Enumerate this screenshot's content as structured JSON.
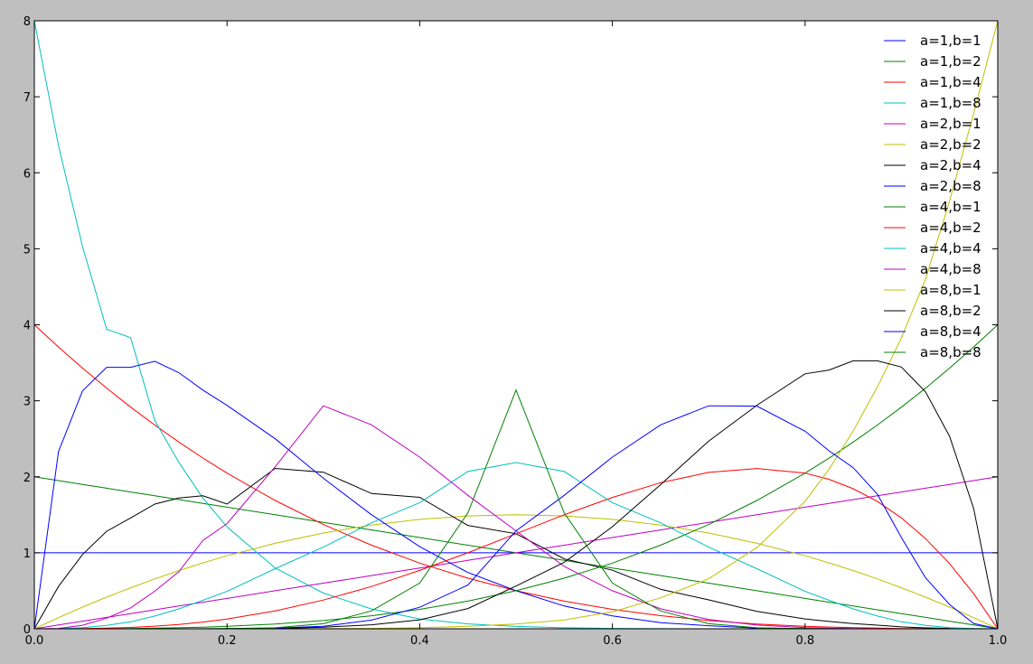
{
  "chart_data": {
    "type": "line",
    "title": "",
    "xlabel": "",
    "ylabel": "",
    "xlim": [
      0.0,
      1.0
    ],
    "ylim": [
      0,
      8
    ],
    "xticks": [
      0.0,
      0.2,
      0.4,
      0.6,
      0.8,
      1.0
    ],
    "xtick_labels": [
      "0.0",
      "0.2",
      "0.4",
      "0.6",
      "0.8",
      "1.0"
    ],
    "yticks": [
      0,
      1,
      2,
      3,
      4,
      5,
      6,
      7,
      8
    ],
    "ytick_labels": [
      "0",
      "1",
      "2",
      "3",
      "4",
      "5",
      "6",
      "7",
      "8"
    ],
    "grid": false,
    "legend_position": "top-right",
    "x_samples": [
      0,
      0.025,
      0.05,
      0.075,
      0.1,
      0.125,
      0.15,
      0.175,
      0.2,
      0.25,
      0.3,
      0.35,
      0.4,
      0.45,
      0.5,
      0.55,
      0.6,
      0.65,
      0.7,
      0.75,
      0.8,
      0.825,
      0.85,
      0.875,
      0.9,
      0.925,
      0.95,
      0.975,
      1
    ],
    "series": [
      {
        "name": "a=1,b=1",
        "color": "#0000ff",
        "y": [
          1,
          1,
          1,
          1,
          1,
          1,
          1,
          1,
          1,
          1,
          1,
          1,
          1,
          1,
          1,
          1,
          1,
          1,
          1,
          1,
          1,
          1,
          1,
          1,
          1,
          1,
          1,
          1,
          1
        ]
      },
      {
        "name": "a=1,b=2",
        "color": "#008000",
        "y": [
          2,
          1.95,
          1.9,
          1.85,
          1.8,
          1.75,
          1.7,
          1.65,
          1.6,
          1.5,
          1.4,
          1.3,
          1.2,
          1.1,
          1,
          0.9,
          0.8,
          0.7,
          0.6,
          0.5,
          0.4,
          0.35,
          0.3,
          0.25,
          0.2,
          0.15,
          0.1,
          0.05,
          0
        ]
      },
      {
        "name": "a=1,b=4",
        "color": "#ff0000",
        "y": [
          4,
          3.707,
          3.43,
          3.167,
          2.916,
          2.68,
          2.457,
          2.247,
          2.048,
          1.688,
          1.372,
          1.099,
          0.864,
          0.666,
          0.5,
          0.364,
          0.256,
          0.172,
          0.108,
          0.063,
          0.032,
          0.022,
          0.014,
          0.008,
          0.004,
          0.002,
          0.0005,
          6e-05,
          0
        ]
      },
      {
        "name": "a=1,b=8",
        "color": "#00bfbf",
        "y": [
          8,
          6.36,
          5.03,
          3.94,
          3.83,
          2.74,
          2.19,
          1.72,
          1.34,
          0.8,
          0.47,
          0.26,
          0.13,
          0.064,
          0.031,
          0.013,
          0.005,
          0.0017,
          0.0005,
          0.0001,
          0,
          0,
          0,
          0,
          0,
          0,
          0,
          0,
          0
        ]
      },
      {
        "name": "a=2,b=1",
        "color": "#bf00bf",
        "y": [
          0,
          0.05,
          0.1,
          0.15,
          0.2,
          0.25,
          0.3,
          0.35,
          0.4,
          0.5,
          0.6,
          0.7,
          0.8,
          0.9,
          1,
          1.1,
          1.2,
          1.3,
          1.4,
          1.5,
          1.6,
          1.65,
          1.7,
          1.75,
          1.8,
          1.85,
          1.9,
          1.95,
          2
        ]
      },
      {
        "name": "a=2,b=2",
        "color": "#bfbf00",
        "y": [
          0,
          0.146,
          0.285,
          0.416,
          0.54,
          0.656,
          0.765,
          0.866,
          0.96,
          1.125,
          1.26,
          1.365,
          1.44,
          1.485,
          1.5,
          1.485,
          1.44,
          1.365,
          1.26,
          1.125,
          0.96,
          0.866,
          0.765,
          0.656,
          0.54,
          0.416,
          0.285,
          0.146,
          0
        ]
      },
      {
        "name": "a=2,b=4",
        "color": "#000000",
        "y": [
          0,
          0.556,
          0.977,
          1.283,
          1.458,
          1.64,
          1.72,
          1.75,
          1.64,
          2.11,
          2.06,
          1.78,
          1.73,
          1.36,
          1.25,
          0.92,
          0.77,
          0.52,
          0.38,
          0.23,
          0.13,
          0.096,
          0.068,
          0.048,
          0.025,
          0.012,
          0.0048,
          0.0013,
          0
        ]
      },
      {
        "name": "a=2,b=8",
        "color": "#0000ff",
        "y": [
          0,
          2.33,
          3.13,
          3.44,
          3.44,
          3.52,
          3.37,
          3.14,
          2.94,
          2.5,
          1.98,
          1.5,
          1.08,
          0.74,
          0.5,
          0.3,
          0.17,
          0.08,
          0.04,
          0.01,
          0.003,
          0.001,
          0.0005,
          0.0001,
          0,
          0,
          0,
          0,
          0
        ]
      },
      {
        "name": "a=4,b=1",
        "color": "#008000",
        "y": [
          0,
          6e-05,
          0.0005,
          0.0017,
          0.004,
          0.0078,
          0.0135,
          0.021,
          0.032,
          0.0625,
          0.108,
          0.171,
          0.256,
          0.364,
          0.5,
          0.666,
          0.864,
          1.099,
          1.372,
          1.688,
          2.048,
          2.246,
          2.457,
          2.68,
          2.916,
          3.166,
          3.43,
          3.707,
          4
        ]
      },
      {
        "name": "a=4,b=2",
        "color": "#ff0000",
        "y": [
          0,
          0.0003,
          0.0024,
          0.0078,
          0.018,
          0.034,
          0.057,
          0.088,
          0.128,
          0.234,
          0.378,
          0.556,
          0.768,
          1.0,
          1.25,
          1.5,
          1.728,
          1.922,
          2.058,
          2.109,
          2.048,
          1.966,
          1.842,
          1.675,
          1.458,
          1.186,
          0.857,
          0.463,
          0
        ]
      },
      {
        "name": "a=4,b=4",
        "color": "#00bfbf",
        "y": [
          0,
          0.0021,
          0.0149,
          0.0449,
          0.0918,
          0.168,
          0.262,
          0.374,
          0.492,
          0.791,
          1.074,
          1.394,
          1.659,
          2.07,
          2.1875,
          2.07,
          1.659,
          1.394,
          1.074,
          0.791,
          0.492,
          0.374,
          0.262,
          0.168,
          0.0918,
          0.0449,
          0.0149,
          0.0021,
          0
        ]
      },
      {
        "name": "a=4,b=8",
        "color": "#bf00bf",
        "y": [
          0,
          0.0048,
          0.0463,
          0.1386,
          0.2756,
          0.495,
          0.751,
          1.163,
          1.384,
          2.131,
          2.934,
          2.683,
          2.258,
          1.756,
          1.289,
          0.82,
          0.5,
          0.263,
          0.123,
          0.049,
          0.016,
          0.007,
          0.003,
          0.001,
          0.0002,
          0,
          0,
          0,
          0
        ]
      },
      {
        "name": "a=8,b=1",
        "color": "#bfbf00",
        "y": [
          0,
          0,
          0,
          0,
          0,
          0,
          0,
          0,
          0.0001,
          0.0005,
          0.0017,
          0.0053,
          0.0131,
          0.0332,
          0.0625,
          0.1165,
          0.2239,
          0.4063,
          0.6588,
          1.0691,
          1.6777,
          2.1008,
          2.6027,
          3.1817,
          3.8264,
          4.6012,
          5.6284,
          6.7788,
          8
        ]
      },
      {
        "name": "a=8,b=2",
        "color": "#000000",
        "y": [
          0,
          0,
          0,
          0,
          0,
          0,
          0,
          0,
          0.001,
          0.0044,
          0.021,
          0.052,
          0.118,
          0.266,
          0.5625,
          0.874,
          1.343,
          1.896,
          2.47,
          2.941,
          3.355,
          3.404,
          3.526,
          3.526,
          3.444,
          3.117,
          2.532,
          1.585,
          0
        ]
      },
      {
        "name": "a=8,b=4",
        "color": "#0000ff",
        "y": [
          0,
          0,
          0,
          0,
          0,
          0,
          0,
          0.0002,
          0.0007,
          0.0088,
          0.0323,
          0.1146,
          0.283,
          0.575,
          1.289,
          1.756,
          2.258,
          2.683,
          2.934,
          2.93,
          2.6,
          2.34,
          2.12,
          1.77,
          1.2,
          0.67,
          0.32,
          0.07,
          0
        ]
      },
      {
        "name": "a=8,b=8",
        "color": "#008000",
        "y": [
          0,
          0,
          0,
          0,
          0,
          0.0001,
          0.0003,
          0.0007,
          0.0024,
          0.0135,
          0.0669,
          0.2354,
          0.6011,
          1.5236,
          3.1421,
          1.5236,
          0.6011,
          0.2354,
          0.0669,
          0.0135,
          0.0024,
          0.0007,
          0.0003,
          0.0001,
          0,
          0,
          0,
          0,
          0
        ]
      }
    ]
  }
}
